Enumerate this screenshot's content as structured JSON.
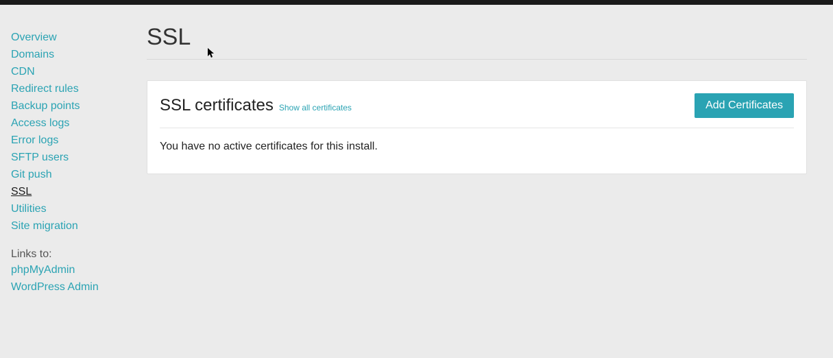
{
  "sidebar": {
    "items": [
      {
        "label": "Overview",
        "active": false
      },
      {
        "label": "Domains",
        "active": false
      },
      {
        "label": "CDN",
        "active": false
      },
      {
        "label": "Redirect rules",
        "active": false
      },
      {
        "label": "Backup points",
        "active": false
      },
      {
        "label": "Access logs",
        "active": false
      },
      {
        "label": "Error logs",
        "active": false
      },
      {
        "label": "SFTP users",
        "active": false
      },
      {
        "label": "Git push",
        "active": false
      },
      {
        "label": "SSL",
        "active": true
      },
      {
        "label": "Utilities",
        "active": false
      },
      {
        "label": "Site migration",
        "active": false
      }
    ],
    "links_label": "Links to:",
    "links": [
      {
        "label": "phpMyAdmin"
      },
      {
        "label": "WordPress Admin"
      }
    ]
  },
  "page": {
    "title": "SSL"
  },
  "panel": {
    "title": "SSL certificates",
    "show_all": "Show all certificates",
    "add_button": "Add Certificates",
    "empty_message": "You have no active certificates for this install."
  }
}
